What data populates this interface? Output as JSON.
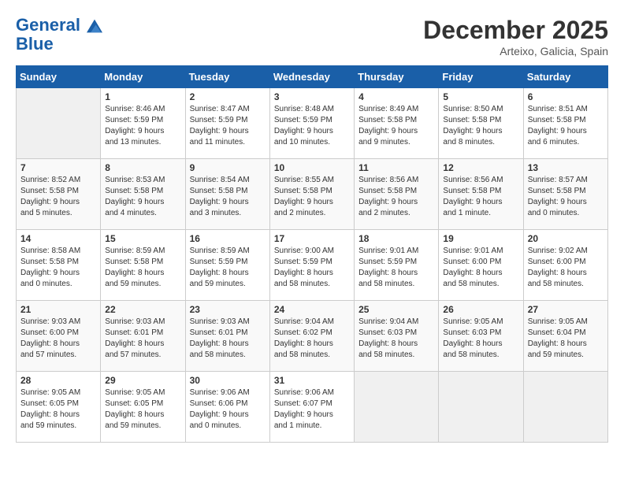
{
  "header": {
    "logo_line1": "General",
    "logo_line2": "Blue",
    "month": "December 2025",
    "location": "Arteixo, Galicia, Spain"
  },
  "weekdays": [
    "Sunday",
    "Monday",
    "Tuesday",
    "Wednesday",
    "Thursday",
    "Friday",
    "Saturday"
  ],
  "weeks": [
    [
      {
        "day": "",
        "info": ""
      },
      {
        "day": "1",
        "info": "Sunrise: 8:46 AM\nSunset: 5:59 PM\nDaylight: 9 hours\nand 13 minutes."
      },
      {
        "day": "2",
        "info": "Sunrise: 8:47 AM\nSunset: 5:59 PM\nDaylight: 9 hours\nand 11 minutes."
      },
      {
        "day": "3",
        "info": "Sunrise: 8:48 AM\nSunset: 5:59 PM\nDaylight: 9 hours\nand 10 minutes."
      },
      {
        "day": "4",
        "info": "Sunrise: 8:49 AM\nSunset: 5:58 PM\nDaylight: 9 hours\nand 9 minutes."
      },
      {
        "day": "5",
        "info": "Sunrise: 8:50 AM\nSunset: 5:58 PM\nDaylight: 9 hours\nand 8 minutes."
      },
      {
        "day": "6",
        "info": "Sunrise: 8:51 AM\nSunset: 5:58 PM\nDaylight: 9 hours\nand 6 minutes."
      }
    ],
    [
      {
        "day": "7",
        "info": "Sunrise: 8:52 AM\nSunset: 5:58 PM\nDaylight: 9 hours\nand 5 minutes."
      },
      {
        "day": "8",
        "info": "Sunrise: 8:53 AM\nSunset: 5:58 PM\nDaylight: 9 hours\nand 4 minutes."
      },
      {
        "day": "9",
        "info": "Sunrise: 8:54 AM\nSunset: 5:58 PM\nDaylight: 9 hours\nand 3 minutes."
      },
      {
        "day": "10",
        "info": "Sunrise: 8:55 AM\nSunset: 5:58 PM\nDaylight: 9 hours\nand 2 minutes."
      },
      {
        "day": "11",
        "info": "Sunrise: 8:56 AM\nSunset: 5:58 PM\nDaylight: 9 hours\nand 2 minutes."
      },
      {
        "day": "12",
        "info": "Sunrise: 8:56 AM\nSunset: 5:58 PM\nDaylight: 9 hours\nand 1 minute."
      },
      {
        "day": "13",
        "info": "Sunrise: 8:57 AM\nSunset: 5:58 PM\nDaylight: 9 hours\nand 0 minutes."
      }
    ],
    [
      {
        "day": "14",
        "info": "Sunrise: 8:58 AM\nSunset: 5:58 PM\nDaylight: 9 hours\nand 0 minutes."
      },
      {
        "day": "15",
        "info": "Sunrise: 8:59 AM\nSunset: 5:58 PM\nDaylight: 8 hours\nand 59 minutes."
      },
      {
        "day": "16",
        "info": "Sunrise: 8:59 AM\nSunset: 5:59 PM\nDaylight: 8 hours\nand 59 minutes."
      },
      {
        "day": "17",
        "info": "Sunrise: 9:00 AM\nSunset: 5:59 PM\nDaylight: 8 hours\nand 58 minutes."
      },
      {
        "day": "18",
        "info": "Sunrise: 9:01 AM\nSunset: 5:59 PM\nDaylight: 8 hours\nand 58 minutes."
      },
      {
        "day": "19",
        "info": "Sunrise: 9:01 AM\nSunset: 6:00 PM\nDaylight: 8 hours\nand 58 minutes."
      },
      {
        "day": "20",
        "info": "Sunrise: 9:02 AM\nSunset: 6:00 PM\nDaylight: 8 hours\nand 58 minutes."
      }
    ],
    [
      {
        "day": "21",
        "info": "Sunrise: 9:03 AM\nSunset: 6:00 PM\nDaylight: 8 hours\nand 57 minutes."
      },
      {
        "day": "22",
        "info": "Sunrise: 9:03 AM\nSunset: 6:01 PM\nDaylight: 8 hours\nand 57 minutes."
      },
      {
        "day": "23",
        "info": "Sunrise: 9:03 AM\nSunset: 6:01 PM\nDaylight: 8 hours\nand 58 minutes."
      },
      {
        "day": "24",
        "info": "Sunrise: 9:04 AM\nSunset: 6:02 PM\nDaylight: 8 hours\nand 58 minutes."
      },
      {
        "day": "25",
        "info": "Sunrise: 9:04 AM\nSunset: 6:03 PM\nDaylight: 8 hours\nand 58 minutes."
      },
      {
        "day": "26",
        "info": "Sunrise: 9:05 AM\nSunset: 6:03 PM\nDaylight: 8 hours\nand 58 minutes."
      },
      {
        "day": "27",
        "info": "Sunrise: 9:05 AM\nSunset: 6:04 PM\nDaylight: 8 hours\nand 59 minutes."
      }
    ],
    [
      {
        "day": "28",
        "info": "Sunrise: 9:05 AM\nSunset: 6:05 PM\nDaylight: 8 hours\nand 59 minutes."
      },
      {
        "day": "29",
        "info": "Sunrise: 9:05 AM\nSunset: 6:05 PM\nDaylight: 8 hours\nand 59 minutes."
      },
      {
        "day": "30",
        "info": "Sunrise: 9:06 AM\nSunset: 6:06 PM\nDaylight: 9 hours\nand 0 minutes."
      },
      {
        "day": "31",
        "info": "Sunrise: 9:06 AM\nSunset: 6:07 PM\nDaylight: 9 hours\nand 1 minute."
      },
      {
        "day": "",
        "info": ""
      },
      {
        "day": "",
        "info": ""
      },
      {
        "day": "",
        "info": ""
      }
    ]
  ]
}
